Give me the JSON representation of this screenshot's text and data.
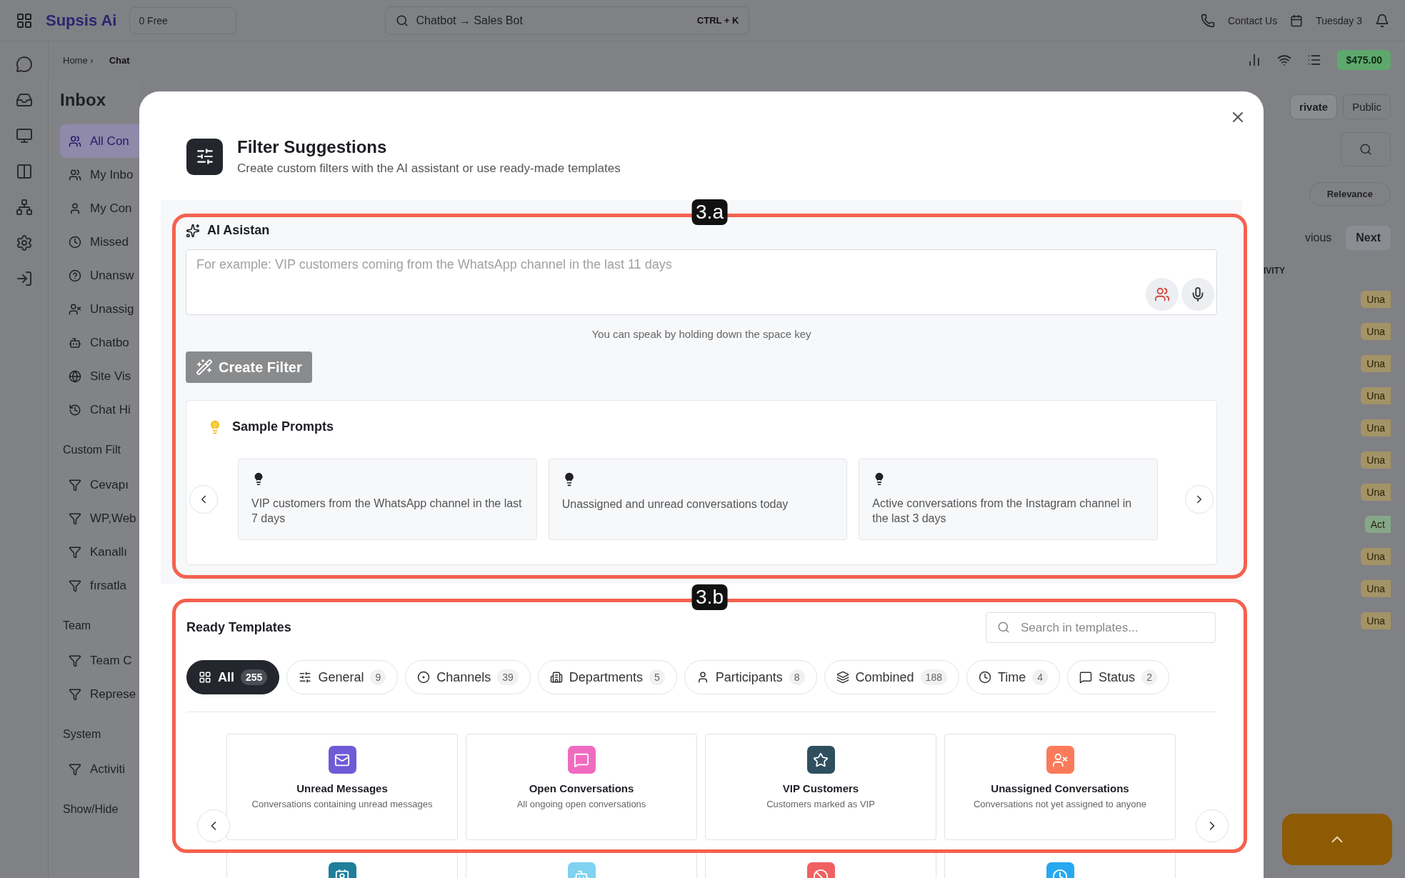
{
  "topbar": {
    "brand": "Supsis Ai",
    "plan": "0 Free",
    "search": "Chatbot → Sales Bot",
    "shortcut": "CTRL + K",
    "contact": "Contact Us",
    "date": "Tuesday 3"
  },
  "subbar": {
    "breadcrumb": "Home ›",
    "current": "Chat",
    "balance": "$475.00"
  },
  "inbox": {
    "title": "Inbox",
    "items": [
      {
        "label": "All Con",
        "selected": true
      },
      {
        "label": "My Inbo",
        "selected": false
      },
      {
        "label": "My Con",
        "selected": false
      },
      {
        "label": "Missed",
        "selected": false
      },
      {
        "label": "Unansw",
        "selected": false
      },
      {
        "label": "Unassig",
        "selected": false
      },
      {
        "label": "Chatbo",
        "selected": false
      },
      {
        "label": "Site Vis",
        "selected": false
      },
      {
        "label": "Chat Hi",
        "selected": false
      }
    ],
    "sections": [
      {
        "title": "Custom Filt",
        "items": [
          "Cevapı",
          "WP,Web",
          "Kanallı",
          "fırsatla"
        ]
      },
      {
        "title": "Team",
        "items": [
          "Team C",
          "Represe"
        ]
      },
      {
        "title": "System",
        "items": [
          "Activiti"
        ]
      }
    ],
    "footer": "Show/Hide"
  },
  "right": {
    "tabs": [
      {
        "label": "rivate",
        "selected": true
      },
      {
        "label": "Public",
        "selected": false
      }
    ],
    "sort": "Relevance",
    "prev": "vious",
    "next": "Next",
    "column": "IVITY",
    "badges": [
      {
        "label": "Una",
        "color": "#a39366"
      },
      {
        "label": "Una",
        "color": "#a39366"
      },
      {
        "label": "Una",
        "color": "#a39366"
      },
      {
        "label": "Una",
        "color": "#a39366"
      },
      {
        "label": "Una",
        "color": "#a39366"
      },
      {
        "label": "Una",
        "color": "#a39366"
      },
      {
        "label": "Una",
        "color": "#a39366"
      },
      {
        "label": "Act",
        "color": "#86a888"
      },
      {
        "label": "Una",
        "color": "#a39366"
      },
      {
        "label": "Una",
        "color": "#a39366"
      },
      {
        "label": "Una",
        "color": "#a39366"
      }
    ]
  },
  "modal": {
    "title": "Filter Suggestions",
    "subtitle": "Create custom filters with the AI assistant or use ready-made templates",
    "ai": {
      "annotation": "3.a",
      "title": "AI Asistan",
      "placeholder": "For example: VIP customers coming from the WhatsApp channel in the last 11 days",
      "hint": "You can speak by holding down the space key",
      "button": "Create Filter",
      "samples_title": "Sample Prompts",
      "prompts": [
        "VIP customers from the WhatsApp channel in the last 7 days",
        "Unassigned and unread conversations today",
        "Active conversations from the Instagram channel in the last 3 days"
      ]
    },
    "templates": {
      "annotation": "3.b",
      "title": "Ready Templates",
      "search_placeholder": "Search in templates...",
      "chips": [
        {
          "label": "All",
          "count": "255",
          "selected": true
        },
        {
          "label": "General",
          "count": "9",
          "selected": false
        },
        {
          "label": "Channels",
          "count": "39",
          "selected": false
        },
        {
          "label": "Departments",
          "count": "5",
          "selected": false
        },
        {
          "label": "Participants",
          "count": "8",
          "selected": false
        },
        {
          "label": "Combined",
          "count": "188",
          "selected": false
        },
        {
          "label": "Time",
          "count": "4",
          "selected": false
        },
        {
          "label": "Status",
          "count": "2",
          "selected": false
        }
      ],
      "cards": [
        {
          "title": "Unread Messages",
          "description": "Conversations containing unread messages",
          "color": "#6f5bd6"
        },
        {
          "title": "Open Conversations",
          "description": "All ongoing open conversations",
          "color": "#f06bc0"
        },
        {
          "title": "VIP Customers",
          "description": "Customers marked as VIP",
          "color": "#2f4f5f"
        },
        {
          "title": "Unassigned Conversations",
          "description": "Conversations not yet assigned to anyone",
          "color": "#fb7a5a"
        },
        {
          "color": "#1f7f9a"
        },
        {
          "color": "#7fd3f0"
        },
        {
          "color": "#f06060"
        },
        {
          "color": "#28a8f0"
        }
      ]
    }
  }
}
